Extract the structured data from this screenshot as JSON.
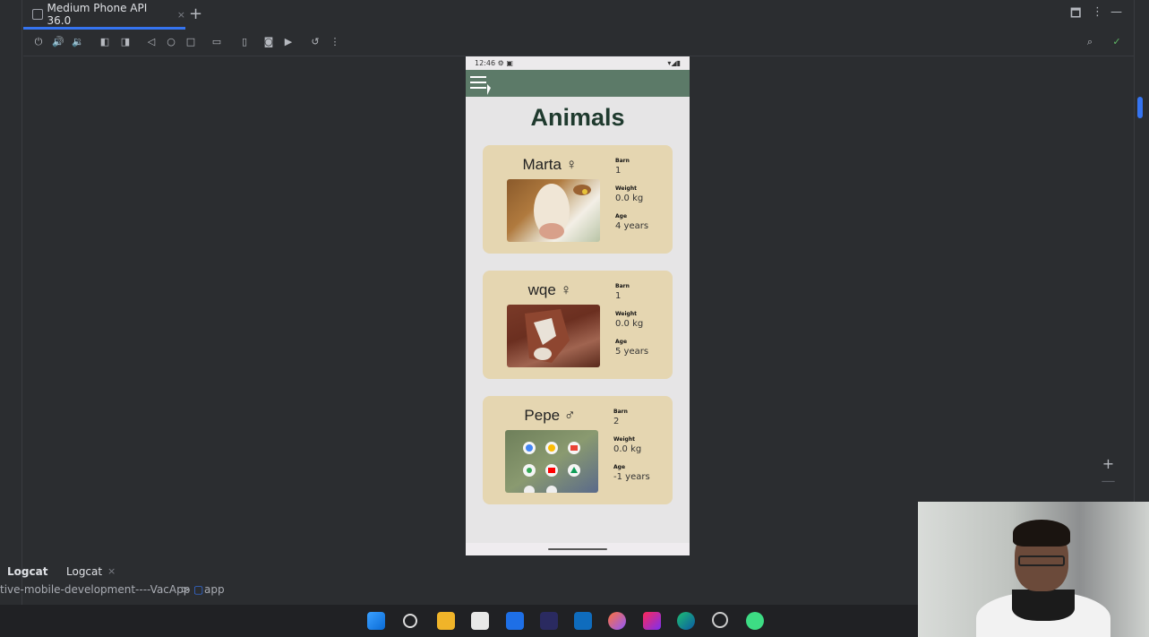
{
  "tabbar": {
    "tab_title": "Medium Phone API 36.0",
    "tab_close": "×",
    "add_tab": "+"
  },
  "window_buttons": {
    "maximize": "🗖",
    "more": "⋮",
    "minimize": "—"
  },
  "phone": {
    "status_time": "12:46",
    "status_icons": "⚙ ▣",
    "status_right": "▾◢▮",
    "page_title": "Animals",
    "animals": [
      {
        "name": "Marta",
        "sex": "♀",
        "barn_label": "Barn",
        "barn": "1",
        "weight_label": "Weight",
        "weight": "0.0 kg",
        "age_label": "Age",
        "age": "4 years"
      },
      {
        "name": "wqe",
        "sex": "♀",
        "barn_label": "Barn",
        "barn": "1",
        "weight_label": "Weight",
        "weight": "0.0 kg",
        "age_label": "Age",
        "age": "5 years"
      },
      {
        "name": "Pepe",
        "sex": "♂",
        "barn_label": "Barn",
        "barn": "2",
        "weight_label": "Weight",
        "weight": "0.0 kg",
        "age_label": "Age",
        "age": "-1 years"
      }
    ]
  },
  "zoom": {
    "in": "+",
    "out": "—"
  },
  "bottom": {
    "tab1": "Logcat",
    "tab2": "Logcat",
    "tab2_close": "×",
    "breadcrumb_project": "tive-mobile-development----VacApp",
    "breadcrumb_sep": ">",
    "breadcrumb_module": "app"
  },
  "colors": {
    "appbar": "#5c7a68",
    "card": "#e5d6b1",
    "title": "#1f3a2e",
    "accent": "#3574f0"
  }
}
